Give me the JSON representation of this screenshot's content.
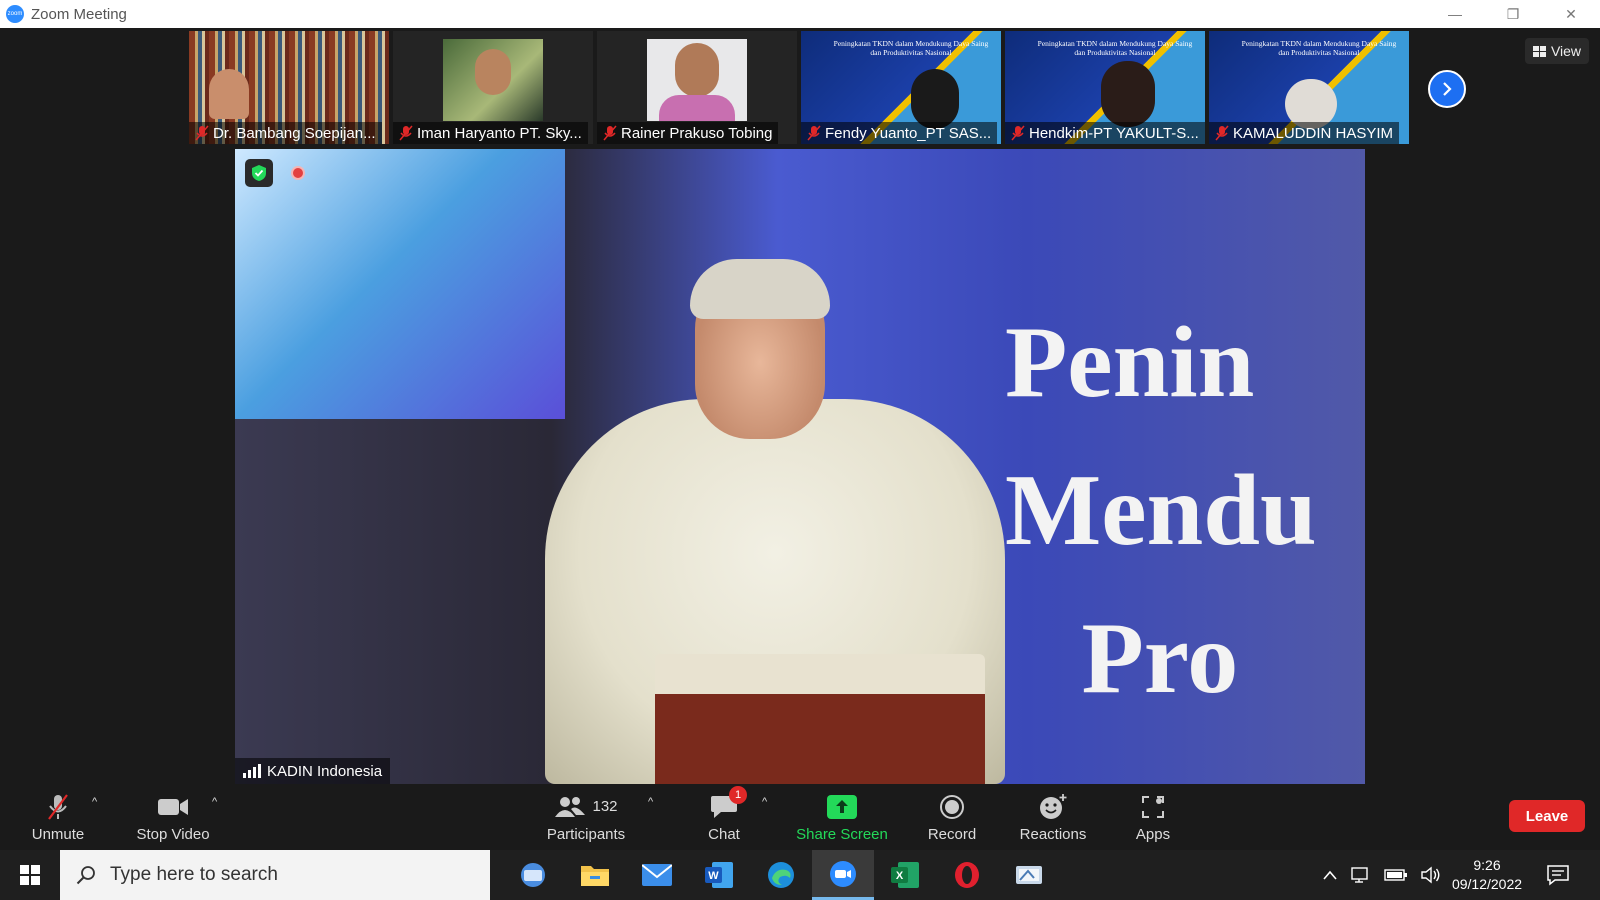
{
  "window": {
    "title": "Zoom Meeting",
    "logo_text": "zoom",
    "minimize": "—",
    "restore": "❐",
    "close": "✕"
  },
  "participants_strip": [
    {
      "name": "Dr. Bambang Soepijan...",
      "kind": "books"
    },
    {
      "name": "Iman Haryanto PT. Sky...",
      "kind": "photo"
    },
    {
      "name": "Rainer Prakuso Tobing",
      "kind": "photo"
    },
    {
      "name": "Fendy Yuanto_PT SAS...",
      "kind": "banner"
    },
    {
      "name": "Hendkim-PT YAKULT-S...",
      "kind": "banner"
    },
    {
      "name": "KAMALUDDIN HASYIM",
      "kind": "banner"
    }
  ],
  "banner_thumb_text": "Peningkatan TKDN dalam Mendukung Daya Saing dan Produktivitas Nasional",
  "view_button": "View",
  "main_video": {
    "label": "KADIN Indonesia",
    "banner_text": "Penin\nMendu\n   Pro"
  },
  "toolbar": {
    "unmute": "Unmute",
    "stop_video": "Stop Video",
    "participants": "Participants",
    "participants_count": "132",
    "chat": "Chat",
    "chat_badge": "1",
    "share_screen": "Share Screen",
    "record": "Record",
    "reactions": "Reactions",
    "apps": "Apps",
    "leave": "Leave",
    "caret": "^"
  },
  "colors": {
    "accent": "#2d8cff",
    "leave": "#e02828",
    "share": "#23d959"
  },
  "taskbar": {
    "search_placeholder": "Type here to search",
    "time": "9:26",
    "date": "09/12/2022"
  }
}
